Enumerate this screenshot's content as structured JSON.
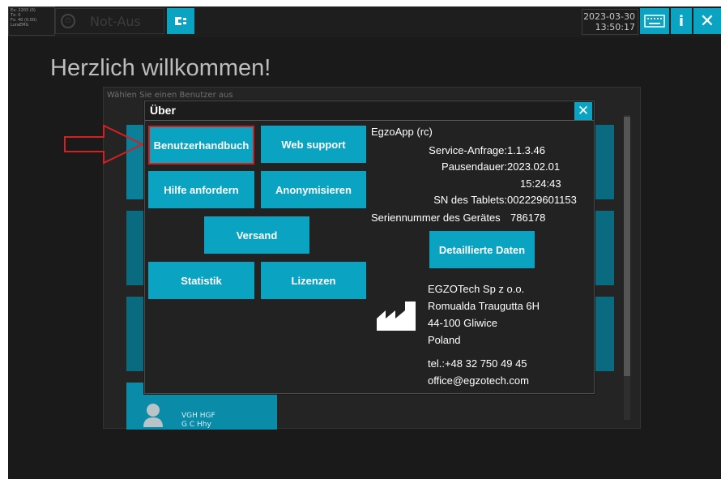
{
  "status": {
    "lines": [
      "Ex: 2203 (0)",
      "Tx: 0",
      "Fx: 40 (0.00)",
      "LuraEMG"
    ]
  },
  "topbar": {
    "estop_label": "Not-Aus",
    "connect_icon": "plug-icon",
    "date": "2023-03-30",
    "time": "13:50:17",
    "keyboard_icon": "keyboard-icon",
    "info_label": "i",
    "close_label": "✕"
  },
  "welcome": "Herzlich willkommen!",
  "user_panel": {
    "label": "Wählen Sie einen Benutzer aus",
    "bottom_user": {
      "line1": "VGH HGF",
      "line2": "G C Hhy"
    }
  },
  "modal": {
    "title": "Über",
    "close_label": "✕",
    "buttons": {
      "manual": "Benutzerhandbuch",
      "web_support": "Web support",
      "help": "Hilfe anfordern",
      "anonymize": "Anonymisieren",
      "shipping": "Versand",
      "statistics": "Statistik",
      "licenses": "Lizenzen",
      "details": "Detaillierte Daten"
    },
    "info": {
      "app_name": "EgzoApp (rc)",
      "service_label": "Service-Anfrage:",
      "service_value": "1.1.3.46",
      "pause_label": "Pausendauer:",
      "pause_date": "2023.02.01",
      "pause_time": "15:24:43",
      "sn_tablet_label": "SN des Tablets:",
      "sn_tablet_value": "002229601153",
      "device_sn_label": "Seriennummer des Gerätes",
      "device_sn_value": "786178"
    },
    "company": {
      "name": "EGZOTech Sp z o.o.",
      "street": "Romualda Traugutta 6H",
      "city": "44-100 Gliwice",
      "country": "Poland",
      "tel": "tel.:+48 32 750 49 45",
      "email": "office@egzotech.com"
    }
  },
  "colors": {
    "accent": "#0aa3c2",
    "background": "#1a1a1a",
    "highlight": "#d42020"
  }
}
